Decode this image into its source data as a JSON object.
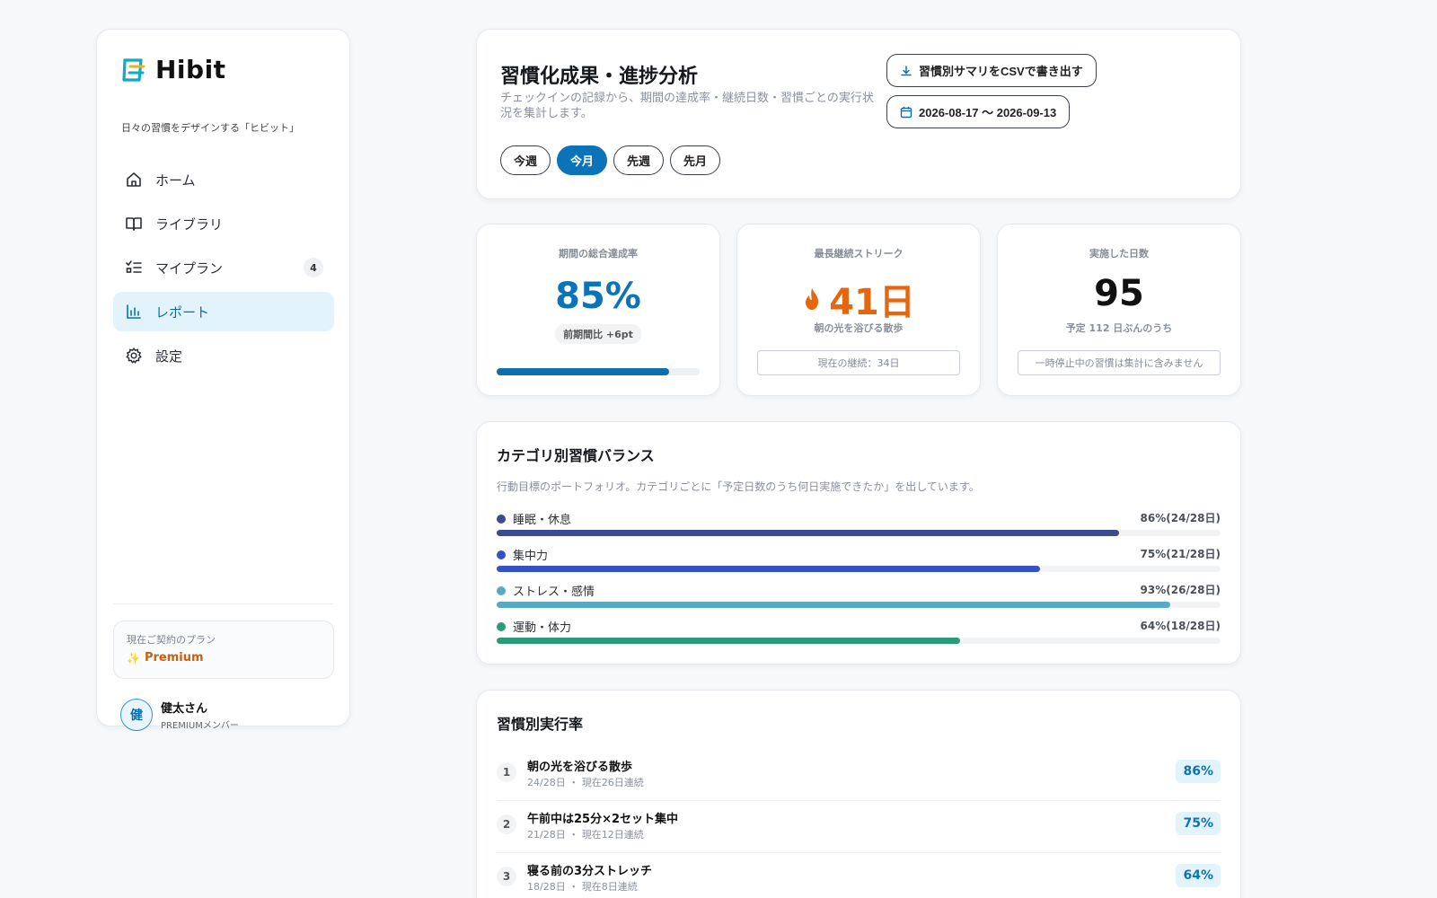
{
  "app": {
    "name": "Hibit",
    "tagline": "日々の習慣をデザインする「ヒビット」"
  },
  "sidebar": {
    "items": [
      {
        "label": "ホーム",
        "icon": "home-icon"
      },
      {
        "label": "ライブラリ",
        "icon": "book-icon"
      },
      {
        "label": "マイプラン",
        "icon": "checklist-icon",
        "badge": "4"
      },
      {
        "label": "レポート",
        "icon": "bar-chart-icon",
        "active": true
      },
      {
        "label": "設定",
        "icon": "gear-icon"
      }
    ],
    "plan": {
      "caption": "現在ご契約のプラン",
      "name": "Premium"
    },
    "user": {
      "avatar_char": "健",
      "name": "健太さん",
      "role": "PREMIUMメンバー"
    }
  },
  "header": {
    "title": "習慣化成果・進捗分析",
    "description": "チェックインの記録から、期間の達成率・継続日数・習慣ごとの実行状況を集計します。",
    "export_label": "習慣別サマリをCSVで書き出す",
    "date_range": "2026-08-17 〜 2026-09-13",
    "range_tabs": [
      {
        "label": "今週",
        "active": false
      },
      {
        "label": "今月",
        "active": true
      },
      {
        "label": "先週",
        "active": false
      },
      {
        "label": "先月",
        "active": false
      }
    ]
  },
  "kpis": {
    "achievement": {
      "label": "期間の総合達成率",
      "value": "85%",
      "delta": "前期間比 +6pt",
      "progress": 0.85
    },
    "streak": {
      "label": "最長継続ストリーク",
      "value": "41日",
      "habit": "朝の光を浴びる散歩",
      "note": "現在の継続：34日"
    },
    "days": {
      "label": "実施した日数",
      "value": "95",
      "sub": "予定 112 日ぶんのうち",
      "note": "一時停止中の習慣は集計に含みません"
    }
  },
  "categories": {
    "title": "カテゴリ別習慣バランス",
    "description": "行動目標のポートフォリオ。カテゴリごとに「予定日数のうち何日実施できたか」を出しています。",
    "items": [
      {
        "label": "睡眠・休息",
        "value": "86%(24/28日)",
        "ratio": 0.86,
        "color": "#3c4a8f"
      },
      {
        "label": "集中力",
        "value": "75%(21/28日)",
        "ratio": 0.75,
        "color": "#3551c9"
      },
      {
        "label": "ストレス・感情",
        "value": "93%(26/28日)",
        "ratio": 0.93,
        "color": "#5ba8c2"
      },
      {
        "label": "運動・体力",
        "value": "64%(18/28日)",
        "ratio": 0.64,
        "color": "#2a9a78"
      }
    ]
  },
  "habits": {
    "title": "習慣別実行率",
    "items": [
      {
        "rank": "1",
        "name": "朝の光を浴びる散歩",
        "meta": "24/28日 ・ 現在26日連続",
        "rate": "86%"
      },
      {
        "rank": "2",
        "name": "午前中は25分×2セット集中",
        "meta": "21/28日 ・ 現在12日連続",
        "rate": "75%"
      },
      {
        "rank": "3",
        "name": "寝る前の3分ストレッチ",
        "meta": "18/28日 ・ 現在8日連続",
        "rate": "64%"
      }
    ]
  },
  "colors": {
    "accent": "#0b74b8",
    "accent_bg": "#e2f3fc",
    "streak": "#e4660f",
    "premium": "#c7610f"
  }
}
